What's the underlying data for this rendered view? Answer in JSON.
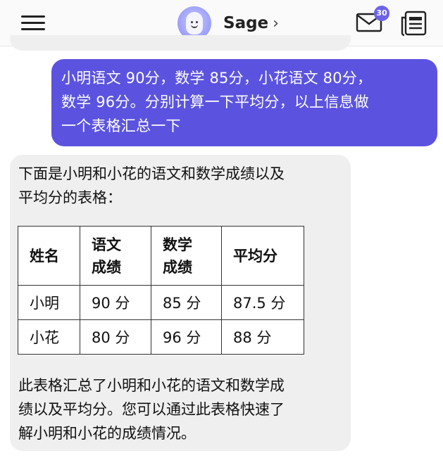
{
  "header": {
    "bot_name": "Sage",
    "chevron": "›",
    "inbox_badge": "30",
    "icons": {
      "menu": "hamburger-menu-icon",
      "inbox": "envelope-icon",
      "doc": "document-list-icon",
      "chevron": "chevron-right-icon"
    }
  },
  "colors": {
    "user_bubble": "#5b53e0",
    "bot_bubble": "#efefef",
    "badge": "#6d63e8",
    "avatar": "#9a9dfa"
  },
  "messages": {
    "user": {
      "line1": "小明语文 90分，数学 85分，小花语文 80分，",
      "line2": "数学 96分。分别计算一下平均分，以上信息做",
      "line3": "一个表格汇总一下"
    },
    "bot": {
      "intro_line1": "下面是小明和小花的语文和数学成绩以及",
      "intro_line2": "平均分的表格：",
      "table": {
        "headers": [
          {
            "line1": "姓名",
            "line2": ""
          },
          {
            "line1": "语文",
            "line2": "成绩"
          },
          {
            "line1": "数学",
            "line2": "成绩"
          },
          {
            "line1": "平均分",
            "line2": ""
          }
        ],
        "rows": [
          [
            "小明",
            "90 分",
            "85 分",
            "87.5 分"
          ],
          [
            "小花",
            "80 分",
            "96 分",
            "88 分"
          ]
        ]
      },
      "outro_line1": "此表格汇总了小明和小花的语文和数学成",
      "outro_line2": "绩以及平均分。您可以通过此表格快速了",
      "outro_line3": "解小明和小花的成绩情况。"
    }
  }
}
